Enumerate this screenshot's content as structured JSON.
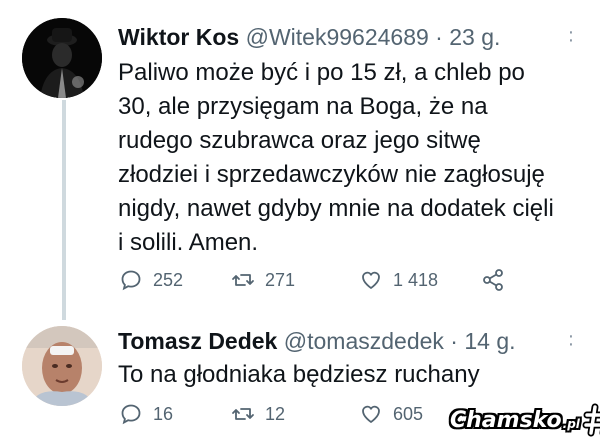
{
  "tweets": [
    {
      "author": "Wiktor Kos",
      "handle": "@Witek99624689",
      "separator": "·",
      "time": "23 g.",
      "text": "Paliwo może być i po 15 zł, a chleb po\n30, ale przysięgam na Boga, że na\nrudego szubrawca oraz jego sitwę\nzłodziei i sprzedawczyków nie zagłosuję\nnigdy, nawet gdyby mnie na dodatek cięli\ni solili. Amen.",
      "replies": "252",
      "retweets": "271",
      "likes": "1 418",
      "icons": [
        "reply-icon",
        "retweet-icon",
        "like-icon",
        "share-icon"
      ]
    },
    {
      "author": "Tomasz Dedek",
      "handle": "@tomaszdedek",
      "separator": "·",
      "time": "14 g.",
      "text": "To na głodniaka będziesz ruchany",
      "replies": "16",
      "retweets": "12",
      "likes": "605",
      "icons": [
        "reply-icon",
        "retweet-icon",
        "like-icon"
      ]
    }
  ],
  "watermark": {
    "text": "Chamsko",
    "suffix": ".pl"
  },
  "colors": {
    "text": "#0f1419",
    "secondary": "#536471",
    "thread": "#cfd9de"
  }
}
